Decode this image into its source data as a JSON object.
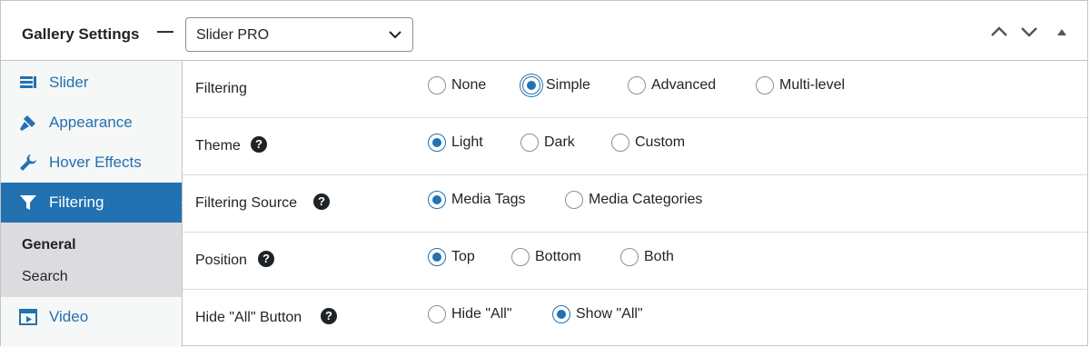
{
  "header": {
    "title": "Gallery Settings",
    "separator": "—",
    "selected_gallery_type": "Slider PRO",
    "controls": [
      "chevron-up-icon",
      "chevron-down-icon",
      "triangle-up-icon"
    ]
  },
  "sidebar": {
    "items": [
      {
        "label": "Slider",
        "icon": "slider-icon"
      },
      {
        "label": "Appearance",
        "icon": "brush-icon"
      },
      {
        "label": "Hover Effects",
        "icon": "wrench-icon"
      },
      {
        "label": "Filtering",
        "icon": "filter-icon",
        "active": true
      },
      {
        "label": "Video",
        "icon": "video-icon"
      }
    ],
    "submenu": [
      {
        "label": "General",
        "active": true
      },
      {
        "label": "Search"
      }
    ]
  },
  "settings": [
    {
      "label": "Filtering",
      "help": false,
      "options": [
        "None",
        "Simple",
        "Advanced",
        "Multi-level"
      ],
      "selected": "Simple"
    },
    {
      "label": "Theme",
      "help": true,
      "options": [
        "Light",
        "Dark",
        "Custom"
      ],
      "selected": "Light"
    },
    {
      "label": "Filtering Source",
      "help": true,
      "options": [
        "Media Tags",
        "Media Categories"
      ],
      "selected": "Media Tags"
    },
    {
      "label": "Position",
      "help": true,
      "options": [
        "Top",
        "Bottom",
        "Both"
      ],
      "selected": "Top"
    },
    {
      "label": "Hide \"All\" Button",
      "help": true,
      "options": [
        "Hide \"All\"",
        "Show \"All\""
      ],
      "selected": "Show \"All\""
    }
  ],
  "help_glyph": "?",
  "colors": {
    "accent": "#2271b1",
    "text": "#1d2327",
    "border": "#c3c4c7",
    "sidebar_bg": "#f6f7f7"
  }
}
